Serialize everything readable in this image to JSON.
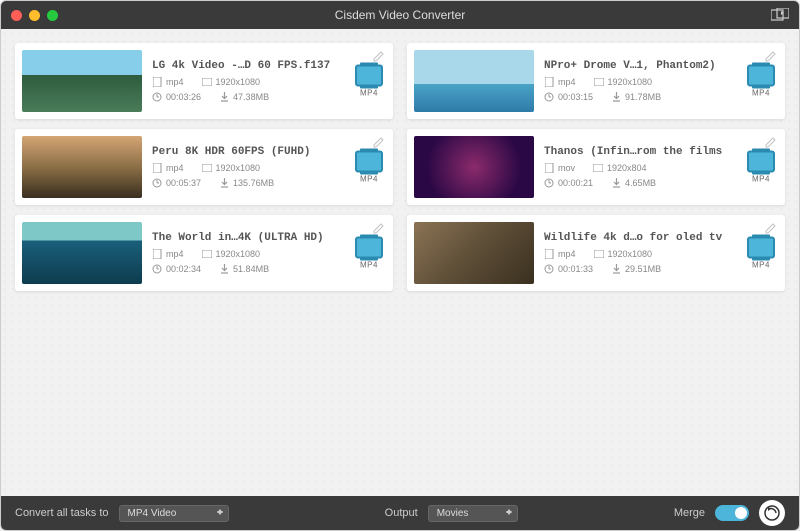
{
  "app": {
    "title": "Cisdem Video Converter"
  },
  "videos": [
    {
      "title": "LG 4k Video -…D 60 FPS.f137",
      "format": "mp4",
      "resolution": "1920x1080",
      "duration": "00:03:26",
      "filesize": "47.38MB",
      "output_format": "MP4",
      "thumb_class": "landscape1"
    },
    {
      "title": "NPro+ Drome V…1, Phantom2)",
      "format": "mp4",
      "resolution": "1920x1080",
      "duration": "00:03:15",
      "filesize": "91.78MB",
      "output_format": "MP4",
      "thumb_class": "landscape2"
    },
    {
      "title": "Peru 8K HDR 60FPS (FUHD)",
      "format": "mp4",
      "resolution": "1920x1080",
      "duration": "00:05:37",
      "filesize": "135.76MB",
      "output_format": "MP4",
      "thumb_class": "landscape3"
    },
    {
      "title": "Thanos (Infin…rom the films",
      "format": "mov",
      "resolution": "1920x804",
      "duration": "00:00:21",
      "filesize": "4.65MB",
      "output_format": "MP4",
      "thumb_class": "landscape4"
    },
    {
      "title": "The World in…4K (ULTRA HD)",
      "format": "mp4",
      "resolution": "1920x1080",
      "duration": "00:02:34",
      "filesize": "51.84MB",
      "output_format": "MP4",
      "thumb_class": "landscape5"
    },
    {
      "title": "Wildlife 4k d…o for oled tv",
      "format": "mp4",
      "resolution": "1920x1080",
      "duration": "00:01:33",
      "filesize": "29.51MB",
      "output_format": "MP4",
      "thumb_class": "landscape6"
    }
  ],
  "footer": {
    "convert_label": "Convert all tasks to",
    "convert_value": "MP4 Video",
    "output_label": "Output",
    "output_value": "Movies",
    "merge_label": "Merge"
  }
}
